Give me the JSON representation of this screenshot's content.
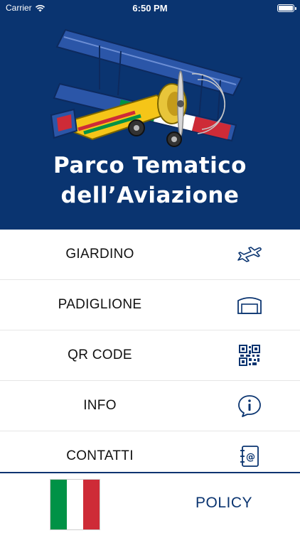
{
  "status_bar": {
    "carrier": "Carrier",
    "time": "6:50 PM",
    "wifi_icon": "wifi-icon",
    "battery_icon": "battery-icon",
    "battery_level": 1.0
  },
  "header": {
    "logo_icon": "biplane-logo",
    "title_line1": "Parco Tematico",
    "title_line2": "dell’Aviazione",
    "background_color": "#0a3470"
  },
  "menu": {
    "items": [
      {
        "label": "GIARDINO",
        "icon": "airplane-icon"
      },
      {
        "label": "PADIGLIONE",
        "icon": "hangar-icon"
      },
      {
        "label": "QR CODE",
        "icon": "qr-code-icon"
      },
      {
        "label": "INFO",
        "icon": "info-bubble-icon"
      },
      {
        "label": "CONTATTI",
        "icon": "address-book-icon"
      }
    ],
    "icon_color": "#0a3470"
  },
  "footer": {
    "flag_icon": "italian-flag-icon",
    "flag_colors": [
      "#009246",
      "#ffffff",
      "#ce2b37"
    ],
    "policy_label": "POLICY"
  }
}
